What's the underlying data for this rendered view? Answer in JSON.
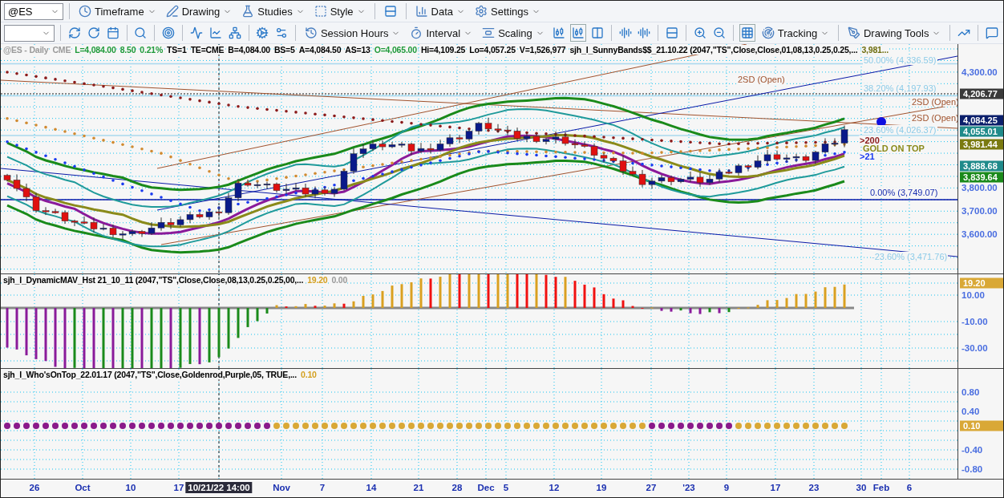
{
  "toolbar": {
    "symbol": "@ES",
    "menus": [
      {
        "label": "Timeframe"
      },
      {
        "label": "Drawing"
      },
      {
        "label": "Studies"
      },
      {
        "label": "Style"
      },
      {
        "label": "Data"
      },
      {
        "label": "Settings"
      }
    ]
  },
  "toolbar2": {
    "menus": [
      {
        "label": "Session Hours"
      },
      {
        "label": "Interval"
      },
      {
        "label": "Scaling"
      },
      {
        "label": "Tracking"
      },
      {
        "label": "Drawing Tools"
      }
    ]
  },
  "price_chart": {
    "legend": [
      {
        "text": "@ES - Daily",
        "color": "#9a9a9a"
      },
      {
        "text": "CME",
        "color": "#9a9a9a"
      },
      {
        "text": "L=4,084.00",
        "color": "#1f9a3a"
      },
      {
        "text": "8.50",
        "color": "#1f9a3a"
      },
      {
        "text": "0.21%",
        "color": "#1f9a3a"
      },
      {
        "text": "TS=1",
        "color": "#000000"
      },
      {
        "text": "TE=CME",
        "color": "#000000"
      },
      {
        "text": "B=4,084.00",
        "color": "#000000"
      },
      {
        "text": "BS=5",
        "color": "#000000"
      },
      {
        "text": "A=4,084.50",
        "color": "#000000"
      },
      {
        "text": "AS=13",
        "color": "#000000"
      },
      {
        "text": "O=4,065.00",
        "color": "#1f9a3a"
      },
      {
        "text": "Hi=4,109.25",
        "color": "#000000"
      },
      {
        "text": "Lo=4,057.25",
        "color": "#000000"
      },
      {
        "text": "V=1,526,977",
        "color": "#000000"
      },
      {
        "text": "sjh_I_SunnyBands$$_21.10.22 (2047,\"TS\",Close,Close,01,08,13,0.25,0.25,...",
        "color": "#000000"
      },
      {
        "text": "3,981...",
        "color": "#6e6e10"
      }
    ],
    "annotations": [
      {
        "text": "50.00% (4,336.59)",
        "kind": "fib"
      },
      {
        "text": "2SD (Open)",
        "kind": "line"
      },
      {
        "text": "38.20% (4,197.93)",
        "kind": "fib"
      },
      {
        "text": "2SD (Open)",
        "kind": "line"
      },
      {
        "text": "2SD (Open)",
        "kind": "line"
      },
      {
        "text": "23.60% (4,026.37)",
        "kind": "fib"
      },
      {
        "text": "0.00% (3,749.07)",
        "kind": "fib-strong"
      },
      {
        "text": "-23.60% (3,471.76)",
        "kind": "fib"
      },
      {
        "text": ">200",
        "kind": "maroon"
      },
      {
        "text": "GOLD ON TOP",
        "kind": "gold"
      },
      {
        "text": ">21",
        "kind": "blue"
      }
    ],
    "axis": [
      {
        "label": "4,300.00",
        "kind": "tick"
      },
      {
        "label": "4,206.77",
        "kind": "flag",
        "color": "#3a3a3a"
      },
      {
        "label": "4,084.25",
        "kind": "flag",
        "color": "#0b1f6b"
      },
      {
        "label": "4,055.01",
        "kind": "flag",
        "color": "#1f8a8a"
      },
      {
        "label": "3,981.44",
        "kind": "flag",
        "color": "#7a7a10"
      },
      {
        "label": "3,888.68",
        "kind": "flag",
        "color": "#1f8a8a"
      },
      {
        "label": "3,839.64",
        "kind": "flag",
        "color": "#1a8a1a"
      },
      {
        "label": "3,800.00",
        "kind": "tick"
      },
      {
        "label": "3,700.00",
        "kind": "tick"
      },
      {
        "label": "3,600.00",
        "kind": "tick"
      }
    ]
  },
  "histogram_pane": {
    "legend": [
      {
        "text": "sjh_I_DynamicMAV_Hst 21_10_11 (2047,\"TS\",Close,Close,08,13,0.25,0.25,00,...",
        "color": "#000000"
      },
      {
        "text": "19.20",
        "color": "#d4a020"
      },
      {
        "text": "0.00",
        "color": "#9a9a9a"
      }
    ],
    "axis": [
      {
        "label": "19.20",
        "kind": "flag",
        "color": "#d9a836"
      },
      {
        "label": "10.00",
        "kind": "tick"
      },
      {
        "label": "-10.00",
        "kind": "tick"
      },
      {
        "label": "-30.00",
        "kind": "tick"
      }
    ]
  },
  "dots_pane": {
    "legend": [
      {
        "text": "sjh_I_Who'sOnTop_22.01.17 (2047,\"TS\",Close,Goldenrod,Purple,05, TRUE,...",
        "color": "#000000"
      },
      {
        "text": "0.10",
        "color": "#d4a020"
      }
    ],
    "axis": [
      {
        "label": "0.80",
        "kind": "tick"
      },
      {
        "label": "0.40",
        "kind": "tick"
      },
      {
        "label": "0.10",
        "kind": "flag",
        "color": "#d9a836"
      },
      {
        "label": "-0.40",
        "kind": "tick"
      },
      {
        "label": "-0.80",
        "kind": "tick"
      }
    ]
  },
  "time_axis": [
    {
      "label": "26",
      "selected": false
    },
    {
      "label": "Oct",
      "selected": false
    },
    {
      "label": "10",
      "selected": false
    },
    {
      "label": "17",
      "selected": false
    },
    {
      "label": "10/21/22 14:00",
      "selected": true
    },
    {
      "label": "Nov",
      "selected": false
    },
    {
      "label": "7",
      "selected": false
    },
    {
      "label": "14",
      "selected": false
    },
    {
      "label": "21",
      "selected": false
    },
    {
      "label": "28",
      "selected": false
    },
    {
      "label": "Dec",
      "selected": false
    },
    {
      "label": "5",
      "selected": false
    },
    {
      "label": "12",
      "selected": false
    },
    {
      "label": "19",
      "selected": false
    },
    {
      "label": "27",
      "selected": false
    },
    {
      "label": "'23",
      "selected": false
    },
    {
      "label": "9",
      "selected": false
    },
    {
      "label": "17",
      "selected": false
    },
    {
      "label": "23",
      "selected": false
    },
    {
      "label": "30",
      "selected": false
    },
    {
      "label": "Feb",
      "selected": false
    },
    {
      "label": "6",
      "selected": false
    }
  ]
}
